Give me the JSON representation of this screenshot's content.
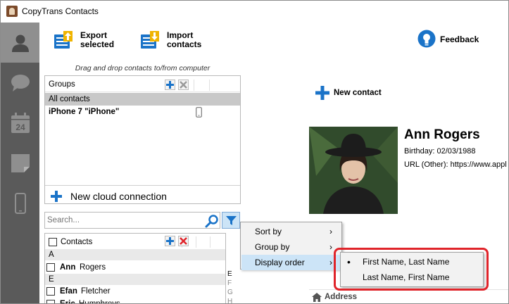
{
  "window": {
    "title": "CopyTrans Contacts"
  },
  "sidebar": {
    "items": [
      {
        "name": "contacts",
        "icon": "person-icon"
      },
      {
        "name": "messages",
        "icon": "speech-bubble-icon"
      },
      {
        "name": "calendars",
        "icon": "calendar-icon",
        "badge": "24"
      },
      {
        "name": "notes",
        "icon": "note-icon"
      },
      {
        "name": "device",
        "icon": "phone-icon"
      }
    ]
  },
  "toolbar": {
    "export_label": "Export\nselected",
    "import_label": "Import\ncontacts",
    "feedback_label": "Feedback"
  },
  "groups_panel": {
    "hint": "Drag and drop contacts to/from computer",
    "header": "Groups",
    "items": [
      "All contacts",
      "iPhone 7 \"iPhone\""
    ],
    "cloud_label": "New cloud connection"
  },
  "search": {
    "placeholder": "Search..."
  },
  "contacts_panel": {
    "header": "Contacts",
    "rows": [
      {
        "type": "letter",
        "text": "A"
      },
      {
        "type": "contact",
        "first": "Ann",
        "last": "Rogers"
      },
      {
        "type": "letter",
        "text": "E"
      },
      {
        "type": "contact",
        "first": "Efan",
        "last": "Fletcher"
      },
      {
        "type": "contact",
        "first": "Eric",
        "last": "Humphreys"
      }
    ],
    "index_letters": [
      "E",
      "F",
      "G",
      "H"
    ]
  },
  "context_menu": {
    "items": [
      "Sort by",
      "Group by",
      "Display order"
    ],
    "submenu": [
      "First Name, Last Name",
      "Last Name, First Name"
    ],
    "selected_index": 0
  },
  "detail": {
    "new_contact_label": "New contact",
    "name": "Ann Rogers",
    "birthday": "Birthday: 02/03/1988",
    "url": "URL (Other): https://www.appl",
    "address_label": "Address"
  },
  "colors": {
    "accent": "#1a73c8",
    "selection": "#c8c8c8",
    "menu_highlight": "#cce4f7",
    "annotation": "#e0242a"
  }
}
